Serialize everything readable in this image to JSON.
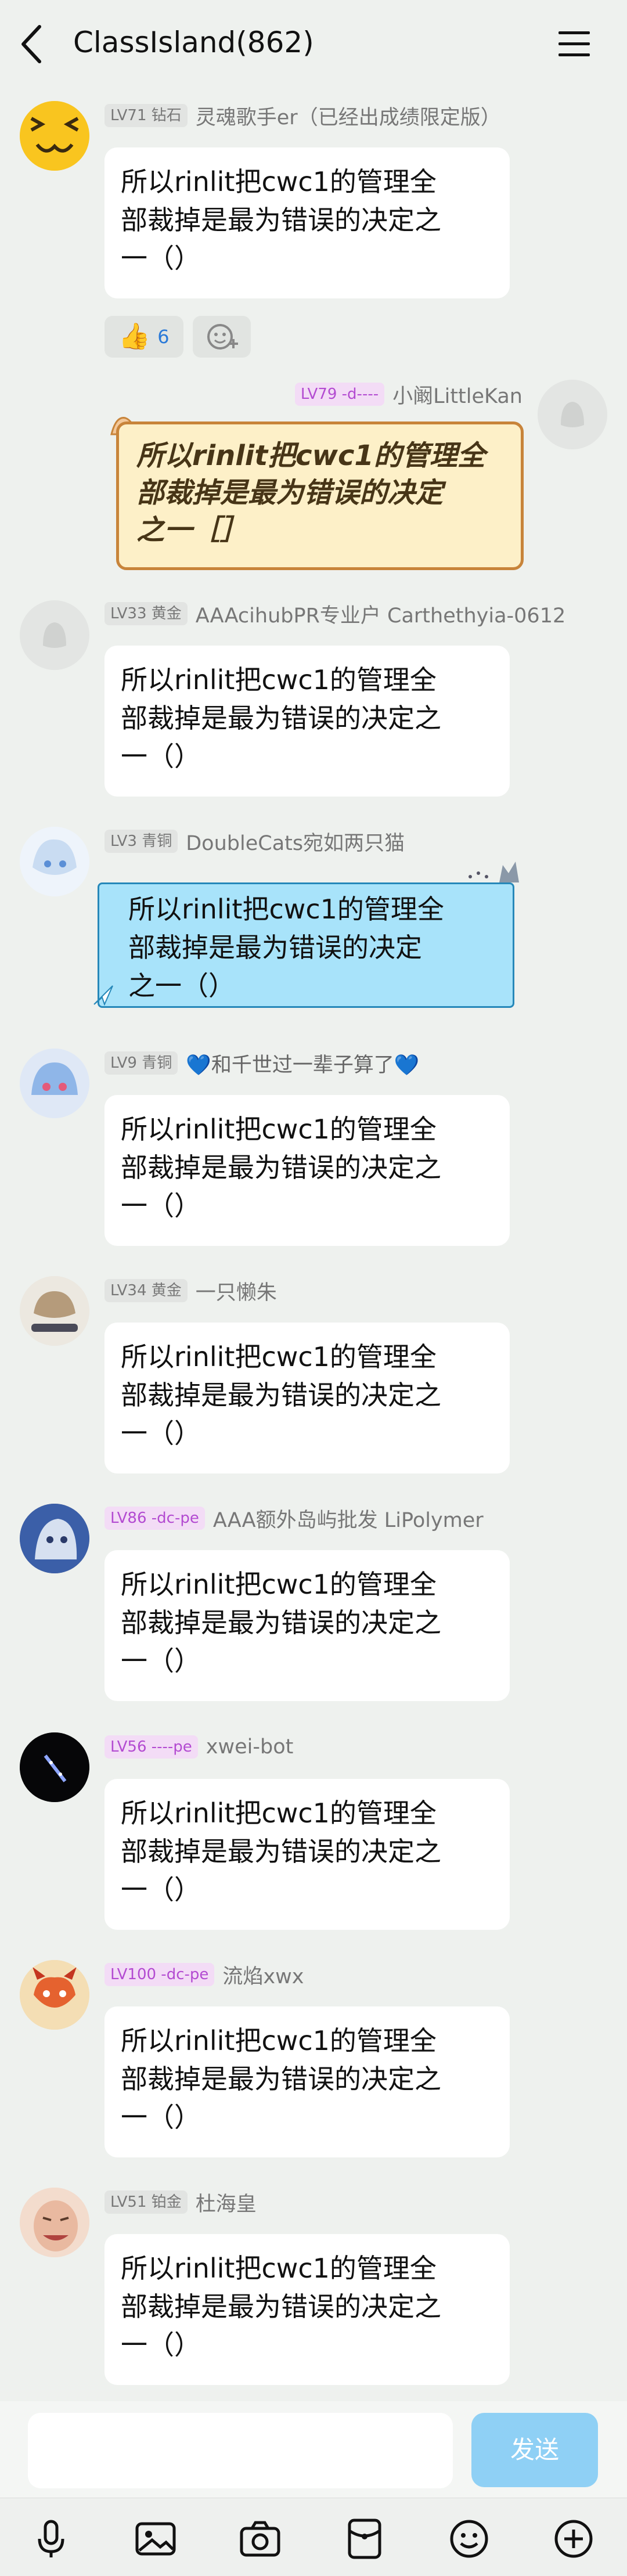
{
  "header": {
    "back_label": "<",
    "title": "ClassIsland(862)",
    "menu_icon": "hamburger-menu-icon"
  },
  "messages": [
    {
      "level": "LV71 钻石",
      "name": "灵魂歌手er（已经出成绩限定版）",
      "text": "所以rinlit把cwc1的管理全部裁掉是最为错误的决定之一（）",
      "line1": "所以rinlit把cwc1的管理全",
      "line2": "部裁掉是最为错误的决定之",
      "line3": "一（）"
    },
    {
      "level": "LV79 -d----",
      "name": "小阚LittleKan",
      "line1": "所以rinlit把cwc1的管理全",
      "line2": "部裁掉是最为错误的决定",
      "line3": "之一［］"
    },
    {
      "level": "LV33 黄金",
      "name": "AAAcihubPR专业户 Carthethyia-0612",
      "line1": "所以rinlit把cwc1的管理全",
      "line2": "部裁掉是最为错误的决定之",
      "line3": "一（）"
    },
    {
      "level": "LV3 青铜",
      "name": "DoubleCats宛如两只猫",
      "line1": "所以rinlit把cwc1的管理全",
      "line2": "部裁掉是最为错误的决定",
      "line3": "之一（）"
    },
    {
      "level": "LV9 青铜",
      "name": "💙和千世过一辈子算了💙",
      "line1": "所以rinlit把cwc1的管理全",
      "line2": "部裁掉是最为错误的决定之",
      "line3": "一（）"
    },
    {
      "level": "LV34 黄金",
      "name": "一只懒朱",
      "line1": "所以rinlit把cwc1的管理全",
      "line2": "部裁掉是最为错误的决定之",
      "line3": "一（）"
    },
    {
      "level": "LV86 -dc-pe",
      "name": "AAA额外岛屿批发 LiPolymer",
      "line1": "所以rinlit把cwc1的管理全",
      "line2": "部裁掉是最为错误的决定之",
      "line3": "一（）"
    },
    {
      "level": "LV56 ----pe",
      "name": "xwei-bot",
      "line1": "所以rinlit把cwc1的管理全",
      "line2": "部裁掉是最为错误的决定之",
      "line3": "一（）"
    },
    {
      "level": "LV100 -dc-pe",
      "name": "流焰xwx",
      "line1": "所以rinlit把cwc1的管理全",
      "line2": "部裁掉是最为错误的决定之",
      "line3": "一（）"
    },
    {
      "level": "LV51 铂金",
      "name": "杜海皇",
      "line1": "所以rinlit把cwc1的管理全",
      "line2": "部裁掉是最为错误的决定之",
      "line3": "一（）"
    }
  ],
  "reactions": {
    "thumbs_count": "6",
    "thumbs_icon": "thumbs-up-icon",
    "add_icon": "add-emoji-icon"
  },
  "input": {
    "placeholder": "",
    "send_label": "发送"
  },
  "toolbar": [
    "microphone-icon",
    "image-icon",
    "camera-icon",
    "red-packet-icon",
    "emoji-icon",
    "plus-icon"
  ],
  "colors": {
    "background": "#eef1ee",
    "send_button": "#8fd0f5",
    "badge_purple": "#b34bd1"
  }
}
